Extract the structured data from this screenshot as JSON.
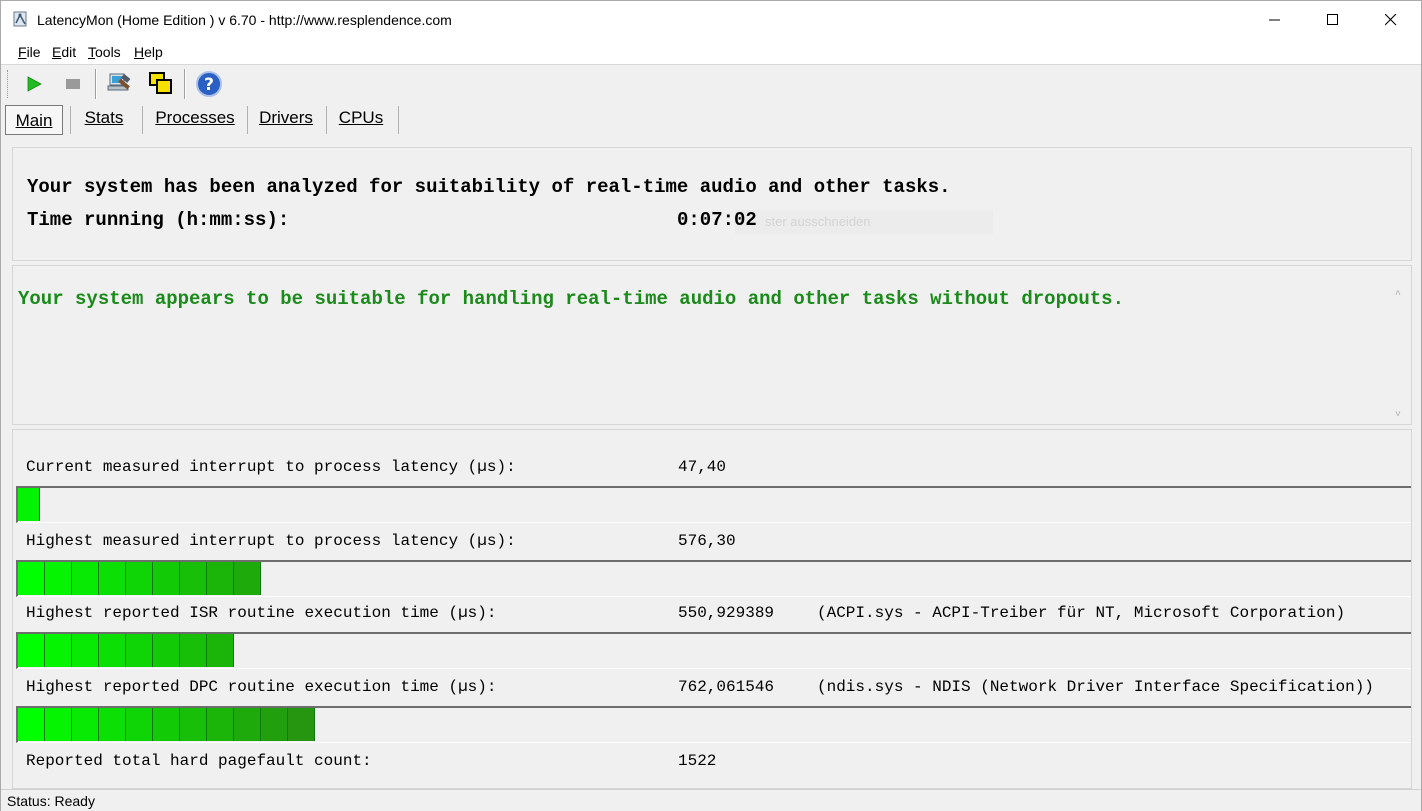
{
  "window": {
    "app_name": "LatencyMon",
    "edition": "(Home Edition )",
    "version": "v 6.70 - http://www.resplendence.com"
  },
  "menu": [
    {
      "key": "F",
      "rest": "ile"
    },
    {
      "key": "E",
      "rest": "dit"
    },
    {
      "key": "T",
      "rest": "ools"
    },
    {
      "key": "H",
      "rest": "elp"
    }
  ],
  "toolbar": {
    "buttons": [
      {
        "icon": "play-icon",
        "color": "#22bb22"
      },
      {
        "icon": "stop-icon",
        "color": "#9a9a9a"
      },
      {
        "icon": "hammer-computer-icon"
      },
      {
        "icon": "windows-overlap-icon",
        "color": "#f5e100"
      },
      {
        "icon": "help-icon",
        "color": "#2a5fc4"
      }
    ]
  },
  "tabs": [
    {
      "label": "Main",
      "active": true
    },
    {
      "label": "Stats",
      "active": false
    },
    {
      "label": "Processes",
      "active": false
    },
    {
      "label": "Drivers",
      "active": false
    },
    {
      "label": "CPUs",
      "active": false
    }
  ],
  "analysis": {
    "line1": "Your system has been analyzed for suitability of real-time audio and other tasks.",
    "time_label": "Time running (h:mm:ss):",
    "time_value": "0:07:02",
    "ghost_tooltip": "ster ausschneiden"
  },
  "verdict": {
    "text": "Your system appears to be suitable for handling real-time audio and other tasks without dropouts.",
    "color": "#1a8a1a"
  },
  "metrics": [
    {
      "label": "Current measured interrupt to process latency (µs):",
      "value": "47,40",
      "extra": "",
      "bar_segments": 1
    },
    {
      "label": "Highest measured interrupt to process latency (µs):",
      "value": "576,30",
      "extra": "",
      "bar_segments": 9
    },
    {
      "label": "Highest reported ISR routine execution time (µs):",
      "value": "550,929389",
      "extra": "(ACPI.sys - ACPI-Treiber für NT, Microsoft Corporation)",
      "bar_segments": 8
    },
    {
      "label": "Highest reported DPC routine execution time (µs):",
      "value": "762,061546",
      "extra": "(ndis.sys - NDIS (Network Driver Interface Specification))",
      "bar_segments": 11
    },
    {
      "label": "Reported total hard pagefault count:",
      "value": "1522",
      "extra": ""
    }
  ],
  "colors": {
    "bar_green_start": "#00ff00",
    "bar_green_end": "#2a8a10"
  },
  "status": {
    "text": "Status: Ready"
  }
}
